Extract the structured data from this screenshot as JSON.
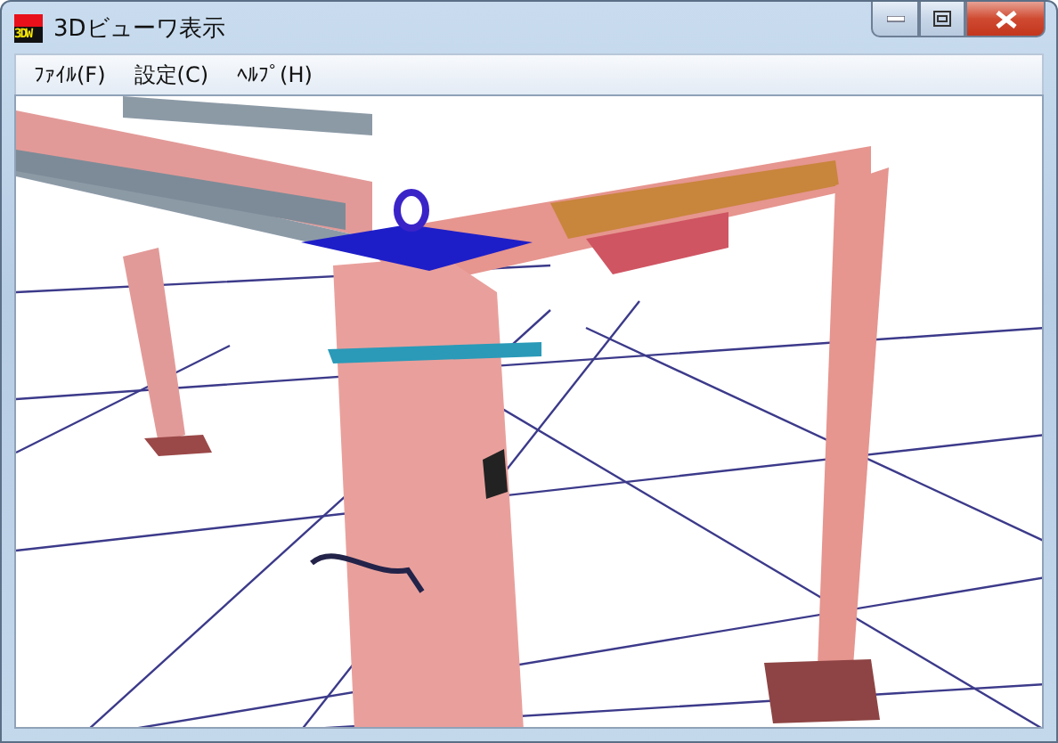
{
  "window": {
    "title": "3Dビューワ表示",
    "icon_text": "3DW"
  },
  "menu": [
    {
      "label": "ﾌｧｲﾙ(F)"
    },
    {
      "label": "設定(C)"
    },
    {
      "label": "ﾍﾙﾌﾟ(H)"
    }
  ]
}
